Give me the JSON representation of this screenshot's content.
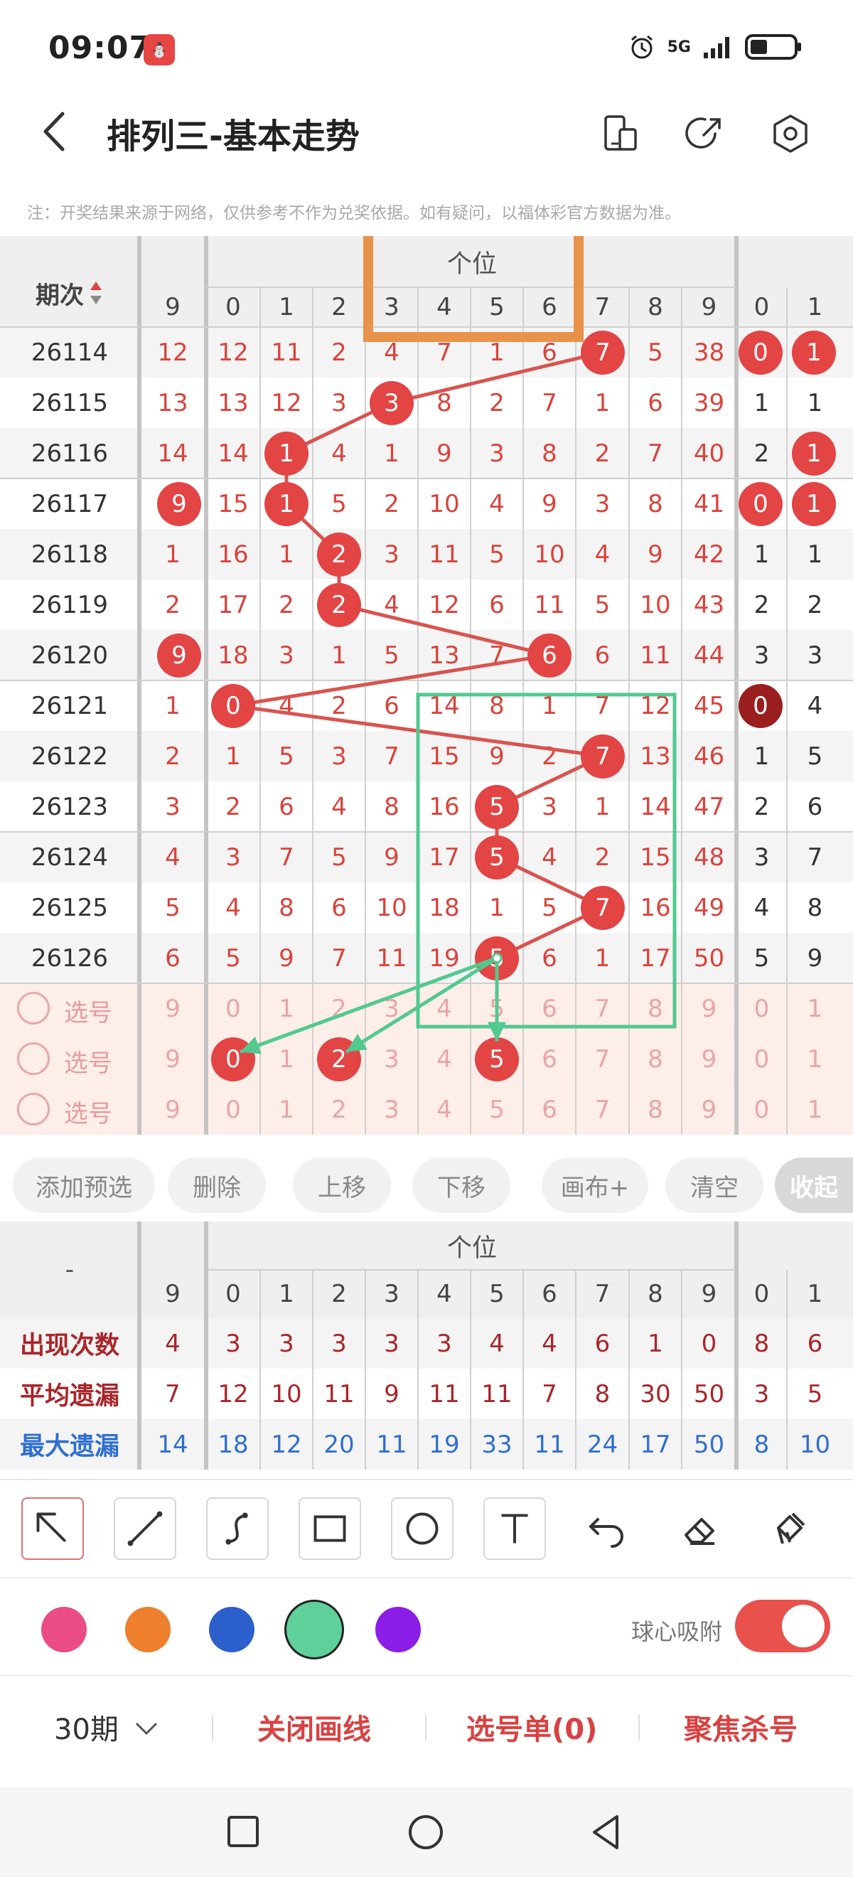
{
  "status_bar": {
    "time": "09:07",
    "app_icon": "lottery-app-icon",
    "network": "5G",
    "battery_level": 0.4
  },
  "header": {
    "title": "排列三-基本走势",
    "back_icon": "chevron-left-icon",
    "icons": [
      "phone-rotate-icon",
      "share-icon",
      "settings-icon"
    ]
  },
  "notice": "注：开奖结果来源于网络，仅供参考不作为兑奖依据。如有疑问，以福体彩官方数据为准。",
  "table": {
    "period_header": "期次",
    "section_label": "个位",
    "columns": [
      "9",
      "0",
      "1",
      "2",
      "3",
      "4",
      "5",
      "6",
      "7",
      "8",
      "9",
      "0",
      "1"
    ],
    "rows": [
      {
        "period": "26114",
        "cells": [
          "12",
          "12",
          "11",
          "2",
          "4",
          "7",
          "1",
          "6",
          "7",
          "5",
          "38",
          "0",
          "1"
        ],
        "balls": [
          8,
          11,
          12
        ]
      },
      {
        "period": "26115",
        "cells": [
          "13",
          "13",
          "12",
          "3",
          "3",
          "8",
          "2",
          "7",
          "1",
          "6",
          "39",
          "1",
          "1"
        ],
        "balls": [
          4
        ]
      },
      {
        "period": "26116",
        "cells": [
          "14",
          "14",
          "1",
          "4",
          "1",
          "9",
          "3",
          "8",
          "2",
          "7",
          "40",
          "2",
          "1"
        ],
        "balls": [
          2,
          12
        ]
      },
      {
        "period": "26117",
        "cells": [
          "9",
          "15",
          "1",
          "5",
          "2",
          "10",
          "4",
          "9",
          "3",
          "8",
          "41",
          "0",
          "1"
        ],
        "balls": [
          0,
          2,
          11,
          12
        ]
      },
      {
        "period": "26118",
        "cells": [
          "1",
          "16",
          "1",
          "2",
          "3",
          "11",
          "5",
          "10",
          "4",
          "9",
          "42",
          "1",
          "1"
        ],
        "balls": [
          3
        ]
      },
      {
        "period": "26119",
        "cells": [
          "2",
          "17",
          "2",
          "2",
          "4",
          "12",
          "6",
          "11",
          "5",
          "10",
          "43",
          "2",
          "2"
        ],
        "balls": [
          3
        ]
      },
      {
        "period": "26120",
        "cells": [
          "9",
          "18",
          "3",
          "1",
          "5",
          "13",
          "7",
          "6",
          "6",
          "11",
          "44",
          "3",
          "3"
        ],
        "balls": [
          0,
          7
        ]
      },
      {
        "period": "26121",
        "cells": [
          "1",
          "0",
          "4",
          "2",
          "6",
          "14",
          "8",
          "1",
          "7",
          "12",
          "45",
          "0",
          "4"
        ],
        "balls": [
          1
        ],
        "dark_balls": [
          11
        ]
      },
      {
        "period": "26122",
        "cells": [
          "2",
          "1",
          "5",
          "3",
          "7",
          "15",
          "9",
          "2",
          "7",
          "13",
          "46",
          "1",
          "5"
        ],
        "balls": [
          8
        ]
      },
      {
        "period": "26123",
        "cells": [
          "3",
          "2",
          "6",
          "4",
          "8",
          "16",
          "5",
          "3",
          "1",
          "14",
          "47",
          "2",
          "6"
        ],
        "balls": [
          6
        ]
      },
      {
        "period": "26124",
        "cells": [
          "4",
          "3",
          "7",
          "5",
          "9",
          "17",
          "5",
          "4",
          "2",
          "15",
          "48",
          "3",
          "7"
        ],
        "balls": [
          6
        ]
      },
      {
        "period": "26125",
        "cells": [
          "5",
          "4",
          "8",
          "6",
          "10",
          "18",
          "1",
          "5",
          "7",
          "16",
          "49",
          "4",
          "8"
        ],
        "balls": [
          8
        ]
      },
      {
        "period": "26126",
        "cells": [
          "6",
          "5",
          "9",
          "7",
          "11",
          "19",
          "5",
          "6",
          "1",
          "17",
          "50",
          "5",
          "9"
        ],
        "balls": [
          6
        ]
      }
    ],
    "select_label": "选号",
    "select_rows": [
      {
        "cells": [
          "9",
          "0",
          "1",
          "2",
          "3",
          "4",
          "5",
          "6",
          "7",
          "8",
          "9",
          "0",
          "1"
        ],
        "balls": []
      },
      {
        "cells": [
          "9",
          "0",
          "1",
          "2",
          "3",
          "4",
          "5",
          "6",
          "7",
          "8",
          "9",
          "0",
          "1"
        ],
        "balls": [
          1,
          3,
          6
        ]
      },
      {
        "cells": [
          "9",
          "0",
          "1",
          "2",
          "3",
          "4",
          "5",
          "6",
          "7",
          "8",
          "9",
          "0",
          "1"
        ],
        "balls": []
      }
    ]
  },
  "actions": [
    "添加预选",
    "删除",
    "上移",
    "下移",
    "画布+",
    "清空",
    "收起"
  ],
  "stats": {
    "header_dash": "-",
    "section_label": "个位",
    "columns": [
      "9",
      "0",
      "1",
      "2",
      "3",
      "4",
      "5",
      "6",
      "7",
      "8",
      "9",
      "0",
      "1"
    ],
    "rows": [
      {
        "label": "出现次数",
        "color": "#a8262a",
        "values": [
          "4",
          "3",
          "3",
          "3",
          "3",
          "3",
          "4",
          "4",
          "6",
          "1",
          "0",
          "8",
          "6"
        ]
      },
      {
        "label": "平均遗漏",
        "color": "#a8262a",
        "values": [
          "7",
          "12",
          "10",
          "11",
          "9",
          "11",
          "11",
          "7",
          "8",
          "30",
          "50",
          "3",
          "5"
        ]
      },
      {
        "label": "最大遗漏",
        "color": "#2f6fd0",
        "values": [
          "14",
          "18",
          "12",
          "20",
          "11",
          "19",
          "33",
          "11",
          "24",
          "17",
          "50",
          "8",
          "10"
        ]
      }
    ]
  },
  "toolbar": {
    "tools": [
      "select-arrow-icon",
      "line-icon",
      "curve-icon",
      "rectangle-icon",
      "circle-icon",
      "text-icon",
      "undo-icon",
      "eraser-icon",
      "clear-brush-icon"
    ],
    "colors": [
      "#ea4c86",
      "#ee7f2d",
      "#2b5fcc",
      "#5fd09a",
      "#8b1ee6"
    ],
    "selected_color": "#5fd09a",
    "snap_label": "球心吸附",
    "snap_on": true
  },
  "bottom_bar": {
    "period_select": "30期",
    "close_lines": "关闭画线",
    "selection_list": "选号单(0)",
    "focus_kill": "聚焦杀号"
  },
  "annotation_colors": {
    "orange_box": "#e8924a",
    "green": "#52c98f",
    "ball_red": "#e34444",
    "line_red": "#d9534f"
  }
}
